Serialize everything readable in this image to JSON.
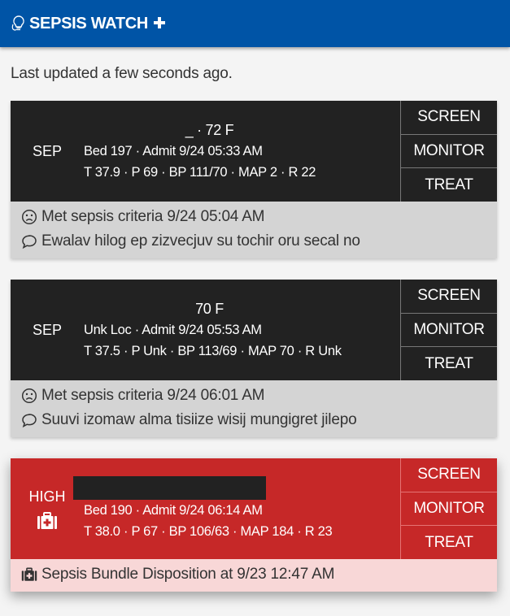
{
  "appbar": {
    "title": "SEPSIS WATCH",
    "logo_icon": "lightbulb-stethoscope-icon",
    "plus_icon": "medical-plus-icon",
    "color": "#0054a6"
  },
  "status": {
    "last_updated": "Last updated a few seconds ago."
  },
  "colors": {
    "dark_card": "#222222",
    "high_card": "#c62828",
    "dark_footer": "#d4d4d4",
    "high_footer": "#f8d7d7"
  },
  "patients": [
    {
      "severity": "SEP",
      "name_line": "_ · 72 F",
      "location_line": "Bed 197 · Admit 9/24 05:33 AM",
      "vitals_line": "T 37.9 · P 69 · BP 111/70 · MAP 2 · R 22",
      "actions": [
        "SCREEN",
        "MONITOR",
        "TREAT"
      ],
      "footer": [
        {
          "icon": "frown-face-icon",
          "text": "Met sepsis criteria 9/24 05:04 AM"
        },
        {
          "icon": "comment-icon",
          "text": "Ewalav hilog ep zizvecjuv su tochir oru secal no"
        }
      ]
    },
    {
      "severity": "SEP",
      "name_line": "70 F",
      "location_line": "Unk Loc · Admit 9/24 05:53 AM",
      "vitals_line": "T 37.5 · P Unk · BP 113/69 · MAP 70 · R Unk",
      "actions": [
        "SCREEN",
        "MONITOR",
        "TREAT"
      ],
      "footer": [
        {
          "icon": "frown-face-icon",
          "text": "Met sepsis criteria 9/24 06:01 AM"
        },
        {
          "icon": "comment-icon",
          "text": "Suuvi izomaw alma tisiize wisij mungigret jilepo"
        }
      ]
    },
    {
      "severity": "HIGH",
      "severity_icon": "medkit-icon",
      "name_line": "",
      "location_line": "Bed 190 · Admit 9/24 06:14 AM",
      "vitals_line": "T 38.0 · P 67 · BP 106/63 · MAP 184 · R 23",
      "actions": [
        "SCREEN",
        "MONITOR",
        "TREAT"
      ],
      "footer": [
        {
          "icon": "medkit-icon",
          "text": "Sepsis Bundle Disposition at 9/23 12:47 AM"
        }
      ]
    }
  ]
}
